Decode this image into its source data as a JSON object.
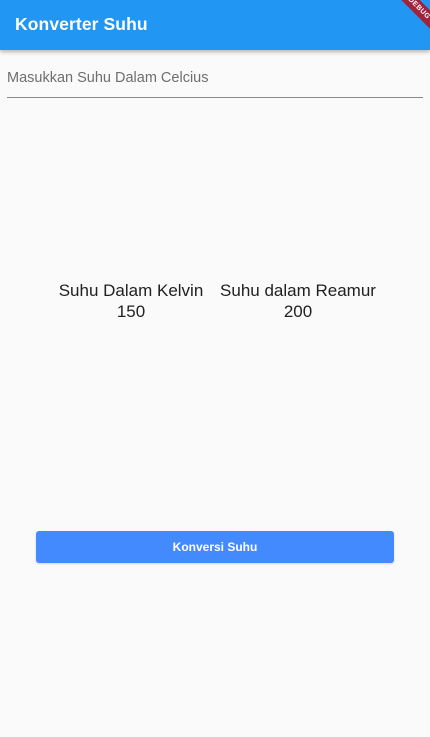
{
  "app_bar": {
    "title": "Konverter Suhu",
    "debug_banner": "DEBUG",
    "color": "#2196f3"
  },
  "input": {
    "value": "",
    "placeholder": "Masukkan Suhu Dalam Celcius"
  },
  "results": {
    "kelvin": {
      "label": "Suhu Dalam Kelvin",
      "value": "150"
    },
    "reamur": {
      "label": "Suhu dalam Reamur",
      "value": "200"
    }
  },
  "convert_button": {
    "label": "Konversi Suhu",
    "color": "#448aff"
  }
}
